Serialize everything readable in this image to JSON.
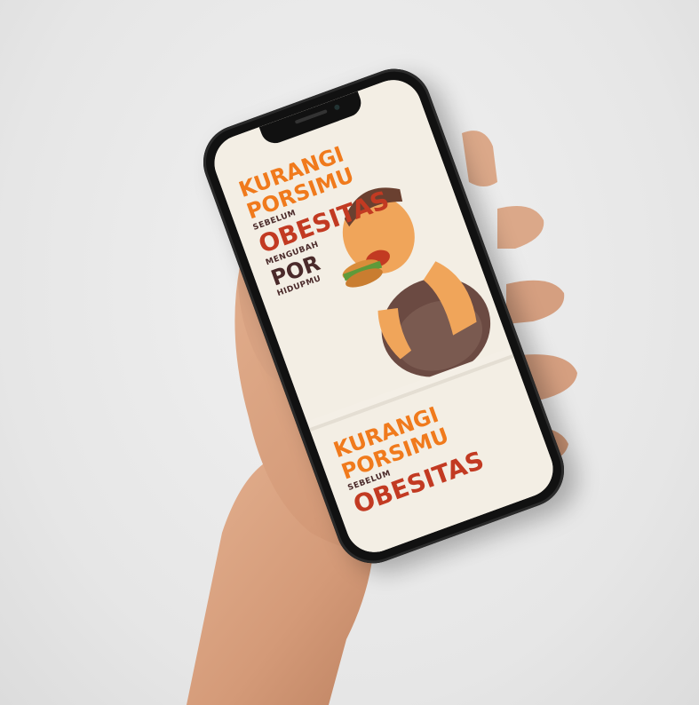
{
  "poster": {
    "line1": "KURANGI",
    "line2": "PORSIMU",
    "line3": "SEBELUM",
    "line4": "OBESITAS",
    "line5": "MENGUBAH",
    "line6": "POR",
    "line7": "HIDUPMU"
  },
  "poster_repeat": {
    "line1": "KURANGI",
    "line2": "PORSIMU",
    "line3": "SEBELUM",
    "line4": "OBESITAS"
  },
  "colors": {
    "background": "#ebebeb",
    "headline_orange": "#f07a1c",
    "headline_red": "#c23a22",
    "subtext_dark": "#4a2a2a",
    "phone_frame": "#111111"
  }
}
